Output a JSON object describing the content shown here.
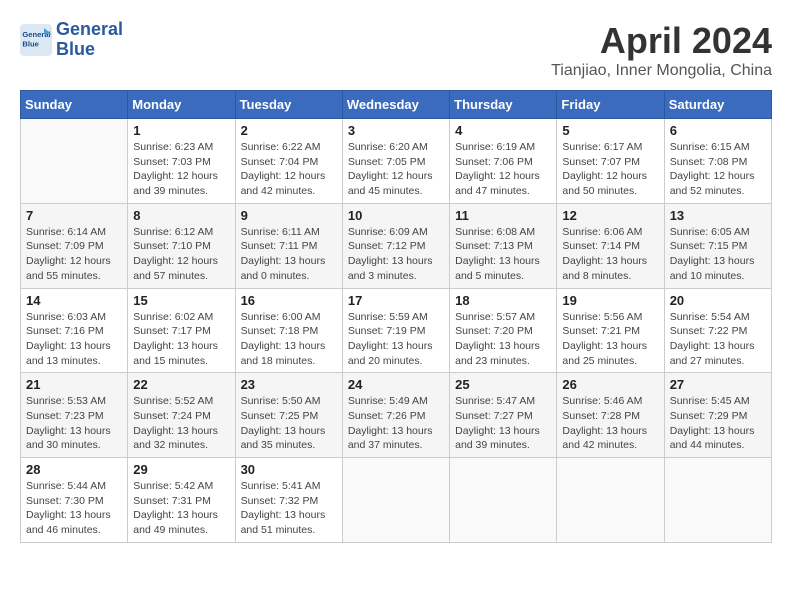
{
  "header": {
    "logo_line1": "General",
    "logo_line2": "Blue",
    "month_title": "April 2024",
    "location": "Tianjiao, Inner Mongolia, China"
  },
  "weekdays": [
    "Sunday",
    "Monday",
    "Tuesday",
    "Wednesday",
    "Thursday",
    "Friday",
    "Saturday"
  ],
  "weeks": [
    [
      {
        "day": "",
        "info": ""
      },
      {
        "day": "1",
        "info": "Sunrise: 6:23 AM\nSunset: 7:03 PM\nDaylight: 12 hours\nand 39 minutes."
      },
      {
        "day": "2",
        "info": "Sunrise: 6:22 AM\nSunset: 7:04 PM\nDaylight: 12 hours\nand 42 minutes."
      },
      {
        "day": "3",
        "info": "Sunrise: 6:20 AM\nSunset: 7:05 PM\nDaylight: 12 hours\nand 45 minutes."
      },
      {
        "day": "4",
        "info": "Sunrise: 6:19 AM\nSunset: 7:06 PM\nDaylight: 12 hours\nand 47 minutes."
      },
      {
        "day": "5",
        "info": "Sunrise: 6:17 AM\nSunset: 7:07 PM\nDaylight: 12 hours\nand 50 minutes."
      },
      {
        "day": "6",
        "info": "Sunrise: 6:15 AM\nSunset: 7:08 PM\nDaylight: 12 hours\nand 52 minutes."
      }
    ],
    [
      {
        "day": "7",
        "info": "Sunrise: 6:14 AM\nSunset: 7:09 PM\nDaylight: 12 hours\nand 55 minutes."
      },
      {
        "day": "8",
        "info": "Sunrise: 6:12 AM\nSunset: 7:10 PM\nDaylight: 12 hours\nand 57 minutes."
      },
      {
        "day": "9",
        "info": "Sunrise: 6:11 AM\nSunset: 7:11 PM\nDaylight: 13 hours\nand 0 minutes."
      },
      {
        "day": "10",
        "info": "Sunrise: 6:09 AM\nSunset: 7:12 PM\nDaylight: 13 hours\nand 3 minutes."
      },
      {
        "day": "11",
        "info": "Sunrise: 6:08 AM\nSunset: 7:13 PM\nDaylight: 13 hours\nand 5 minutes."
      },
      {
        "day": "12",
        "info": "Sunrise: 6:06 AM\nSunset: 7:14 PM\nDaylight: 13 hours\nand 8 minutes."
      },
      {
        "day": "13",
        "info": "Sunrise: 6:05 AM\nSunset: 7:15 PM\nDaylight: 13 hours\nand 10 minutes."
      }
    ],
    [
      {
        "day": "14",
        "info": "Sunrise: 6:03 AM\nSunset: 7:16 PM\nDaylight: 13 hours\nand 13 minutes."
      },
      {
        "day": "15",
        "info": "Sunrise: 6:02 AM\nSunset: 7:17 PM\nDaylight: 13 hours\nand 15 minutes."
      },
      {
        "day": "16",
        "info": "Sunrise: 6:00 AM\nSunset: 7:18 PM\nDaylight: 13 hours\nand 18 minutes."
      },
      {
        "day": "17",
        "info": "Sunrise: 5:59 AM\nSunset: 7:19 PM\nDaylight: 13 hours\nand 20 minutes."
      },
      {
        "day": "18",
        "info": "Sunrise: 5:57 AM\nSunset: 7:20 PM\nDaylight: 13 hours\nand 23 minutes."
      },
      {
        "day": "19",
        "info": "Sunrise: 5:56 AM\nSunset: 7:21 PM\nDaylight: 13 hours\nand 25 minutes."
      },
      {
        "day": "20",
        "info": "Sunrise: 5:54 AM\nSunset: 7:22 PM\nDaylight: 13 hours\nand 27 minutes."
      }
    ],
    [
      {
        "day": "21",
        "info": "Sunrise: 5:53 AM\nSunset: 7:23 PM\nDaylight: 13 hours\nand 30 minutes."
      },
      {
        "day": "22",
        "info": "Sunrise: 5:52 AM\nSunset: 7:24 PM\nDaylight: 13 hours\nand 32 minutes."
      },
      {
        "day": "23",
        "info": "Sunrise: 5:50 AM\nSunset: 7:25 PM\nDaylight: 13 hours\nand 35 minutes."
      },
      {
        "day": "24",
        "info": "Sunrise: 5:49 AM\nSunset: 7:26 PM\nDaylight: 13 hours\nand 37 minutes."
      },
      {
        "day": "25",
        "info": "Sunrise: 5:47 AM\nSunset: 7:27 PM\nDaylight: 13 hours\nand 39 minutes."
      },
      {
        "day": "26",
        "info": "Sunrise: 5:46 AM\nSunset: 7:28 PM\nDaylight: 13 hours\nand 42 minutes."
      },
      {
        "day": "27",
        "info": "Sunrise: 5:45 AM\nSunset: 7:29 PM\nDaylight: 13 hours\nand 44 minutes."
      }
    ],
    [
      {
        "day": "28",
        "info": "Sunrise: 5:44 AM\nSunset: 7:30 PM\nDaylight: 13 hours\nand 46 minutes."
      },
      {
        "day": "29",
        "info": "Sunrise: 5:42 AM\nSunset: 7:31 PM\nDaylight: 13 hours\nand 49 minutes."
      },
      {
        "day": "30",
        "info": "Sunrise: 5:41 AM\nSunset: 7:32 PM\nDaylight: 13 hours\nand 51 minutes."
      },
      {
        "day": "",
        "info": ""
      },
      {
        "day": "",
        "info": ""
      },
      {
        "day": "",
        "info": ""
      },
      {
        "day": "",
        "info": ""
      }
    ]
  ]
}
